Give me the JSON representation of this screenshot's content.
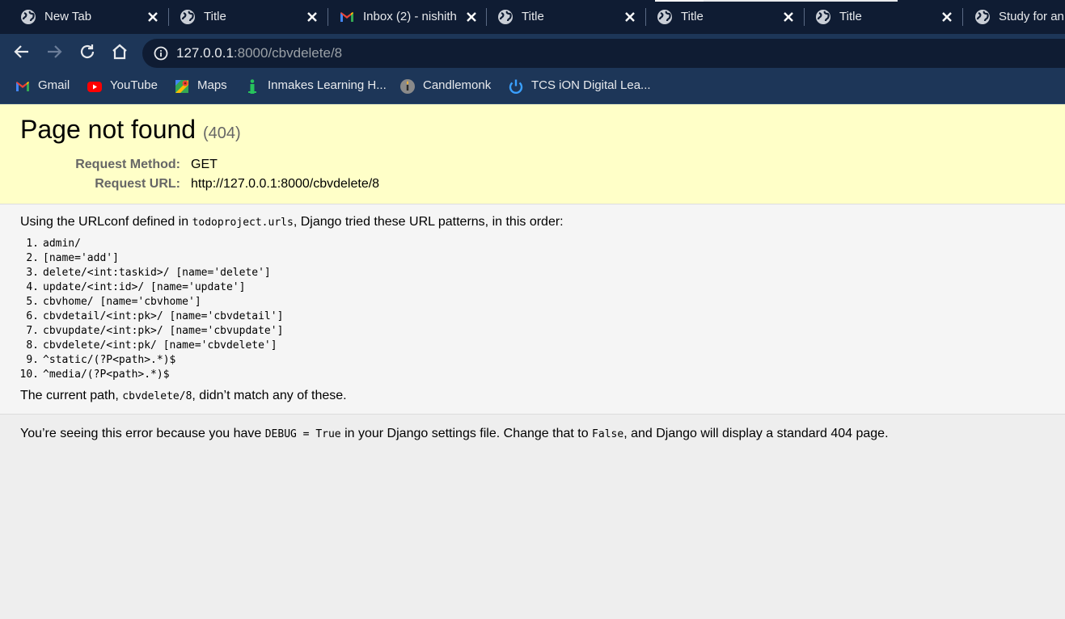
{
  "browser": {
    "tabs": [
      {
        "title": "New Tab",
        "icon": "globe-icon"
      },
      {
        "title": "Title",
        "icon": "globe-icon"
      },
      {
        "title": "Inbox (2) - nishith",
        "icon": "gmail-icon"
      },
      {
        "title": "Title",
        "icon": "globe-icon"
      },
      {
        "title": "Title",
        "icon": "globe-icon"
      },
      {
        "title": "Title",
        "icon": "globe-icon"
      },
      {
        "title": "Study for an",
        "icon": "globe-icon"
      }
    ],
    "url_host": "127.0.0.1",
    "url_rest": ":8000/cbvdelete/8",
    "bookmarks": [
      {
        "label": "Gmail",
        "icon": "gmail-icon"
      },
      {
        "label": "YouTube",
        "icon": "youtube-icon"
      },
      {
        "label": "Maps",
        "icon": "maps-icon"
      },
      {
        "label": "Inmakes Learning H...",
        "icon": "inmakes-icon"
      },
      {
        "label": "Candlemonk",
        "icon": "candlemonk-icon"
      },
      {
        "label": "TCS iON Digital Lea...",
        "icon": "tcs-icon"
      }
    ],
    "colors": {
      "tabbar": "#0f1c33",
      "toolbar": "#1d3658"
    }
  },
  "error": {
    "title": "Page not found",
    "code": "(404)",
    "method_label": "Request Method:",
    "method_value": "GET",
    "url_label": "Request URL:",
    "url_value": "http://127.0.0.1:8000/cbvdelete/8",
    "urlconf_prefix": "Using the URLconf defined in ",
    "urlconf_module": "todoproject.urls",
    "urlconf_suffix": ", Django tried these URL patterns, in this order:",
    "patterns": [
      {
        "num": "1.",
        "text": "admin/"
      },
      {
        "num": "2.",
        "text": "[name='add']"
      },
      {
        "num": "3.",
        "text": "delete/<int:taskid>/ [name='delete']"
      },
      {
        "num": "4.",
        "text": "update/<int:id>/ [name='update']"
      },
      {
        "num": "5.",
        "text": "cbvhome/ [name='cbvhome']"
      },
      {
        "num": "6.",
        "text": "cbvdetail/<int:pk>/ [name='cbvdetail']"
      },
      {
        "num": "7.",
        "text": "cbvupdate/<int:pk>/ [name='cbvupdate']"
      },
      {
        "num": "8.",
        "text": "cbvdelete/<int:pk/ [name='cbvdelete']"
      },
      {
        "num": "9.",
        "text": "^static/(?P<path>.*)$"
      },
      {
        "num": "10.",
        "text": "^media/(?P<path>.*)$"
      }
    ],
    "current_prefix": "The current path, ",
    "current_path": "cbvdelete/8",
    "current_suffix": ", didn’t match any of these.",
    "debug_prefix": "You’re seeing this error because you have ",
    "debug_code": "DEBUG = True",
    "debug_middle": " in your Django settings file. Change that to ",
    "debug_false": "False",
    "debug_suffix": ", and Django will display a standard 404 page."
  }
}
